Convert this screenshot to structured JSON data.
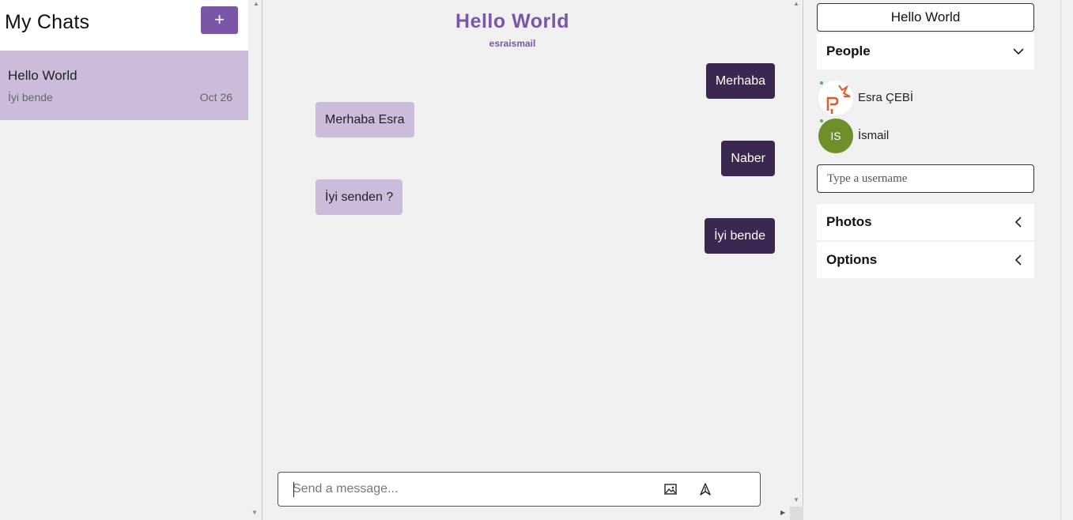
{
  "sidebar": {
    "title": "My Chats",
    "new_chat_label": "+",
    "chats": [
      {
        "title": "Hello World",
        "last_message": "İyi bende",
        "date": "Oct 26"
      }
    ]
  },
  "chat": {
    "title": "Hello World",
    "subtitle": "esraismail",
    "messages": [
      {
        "text": "Merhaba",
        "direction": "out"
      },
      {
        "text": "Merhaba Esra",
        "direction": "in"
      },
      {
        "text": "Naber",
        "direction": "out"
      },
      {
        "text": "İyi senden ?",
        "direction": "in"
      },
      {
        "text": "İyi bende",
        "direction": "out"
      }
    ],
    "composer": {
      "placeholder": "Send a message...",
      "image_icon": "image-icon",
      "send_icon": "send-icon"
    }
  },
  "panel": {
    "title": "Hello World",
    "people_section": {
      "label": "People",
      "state": "expanded"
    },
    "people": [
      {
        "name": "Esra ÇEBİ",
        "avatar": "image",
        "online": true
      },
      {
        "name": "İsmail",
        "initials": "IS",
        "online": true
      }
    ],
    "username_placeholder": "Type a username",
    "photos_section": {
      "label": "Photos",
      "state": "collapsed"
    },
    "options_section": {
      "label": "Options",
      "state": "collapsed"
    }
  },
  "colors": {
    "accent": "#7a56a6",
    "outgoing_bubble": "#3b2850",
    "incoming_bubble": "#cbbcdc",
    "background": "#f0f0f0",
    "avatar_green": "#6e8f2a"
  }
}
